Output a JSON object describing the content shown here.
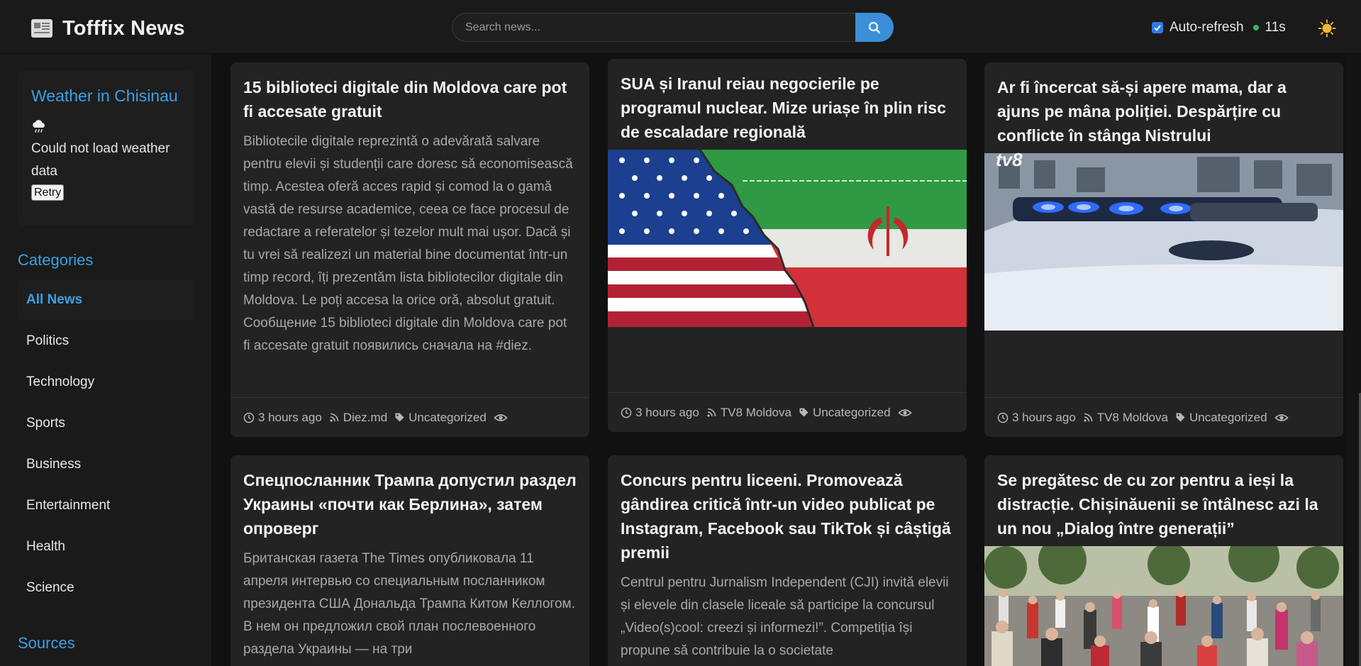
{
  "header": {
    "title": "Tofffix News",
    "search_placeholder": "Search news...",
    "autorefresh_label": "Auto-refresh",
    "autorefresh_checked": true,
    "countdown": "11s",
    "icons": {
      "logo": "newspaper-icon",
      "search": "search-icon",
      "theme": "sun-icon"
    }
  },
  "sidebar": {
    "weather": {
      "title": "Weather in Chisinau",
      "icon": "cloud-rain-icon",
      "message": "Could not load weather data",
      "retry_label": "Retry"
    },
    "categories_heading": "Categories",
    "categories": [
      {
        "label": "All News",
        "active": true
      },
      {
        "label": "Politics",
        "active": false
      },
      {
        "label": "Technology",
        "active": false
      },
      {
        "label": "Sports",
        "active": false
      },
      {
        "label": "Business",
        "active": false
      },
      {
        "label": "Entertainment",
        "active": false
      },
      {
        "label": "Health",
        "active": false
      },
      {
        "label": "Science",
        "active": false
      }
    ],
    "sources_heading": "Sources"
  },
  "articles": [
    {
      "title": "15 biblioteci digitale din Moldova care pot fi accesate gratuit",
      "description": "Bibliotecile digitale reprezintă o adevărată salvare pentru elevii și studenții care doresc să economisească timp. Acestea oferă acces rapid și comod la o gamă vastă de resurse academice, ceea ce face procesul de redactare a referatelor și tezelor mult mai ușor. Dacă și tu vrei să realizezi un material bine documentat într-un timp record, îți prezentăm lista bibliotecilor digitale din Moldova. Le poți accesa la orice oră, absolut gratuit. Сообщение 15 biblioteci digitale din Moldova care pot fi accesate gratuit появились сначала на #diez.",
      "time": "3 hours ago",
      "source": "Diez.md",
      "category": "Uncategorized"
    },
    {
      "title": "SUA și Iranul reiau negocierile pe programul nuclear. Mize uriașe în plin risc de escaladare regională",
      "image": "us-iran-flags-image",
      "time": "3 hours ago",
      "source": "TV8 Moldova",
      "category": "Uncategorized"
    },
    {
      "title": "Ar fi încercat să-și apere mama, dar a ajuns pe mâna poliției. Despărțire cu conflicte în stânga Nistrului",
      "image": "police-car-image",
      "image_watermark": "tv8",
      "time": "3 hours ago",
      "source": "TV8 Moldova",
      "category": "Uncategorized"
    },
    {
      "title": "Спецпосланник Трампа допустил раздел Украины «почти как Берлина», затем опроверг",
      "description": "Британская газета The Times опубликовала 11 апреля интервью со специальным посланником президента США Дональда Трампа Китом Келлогом. В нем он предложил свой план послевоенного раздела Украины — на три"
    },
    {
      "title": "Concurs pentru liceeni. Promovează gândirea critică într-un video publicat pe Instagram, Facebook sau TikTok și câștigă premii",
      "description": "Centrul pentru Jurnalism Independent (CJI) invită elevii și elevele din clasele liceale să participe la concursul „Video(s)cool: creezi și informezi!”. Competiția își propune să contribuie la o societate"
    },
    {
      "title": "Se pregătesc de cu zor pentru a ieși la distracție. Chișinăuenii se întâlnesc azi la un nou „Dialog între generații”",
      "image": "dancing-crowd-park-image"
    }
  ],
  "colors": {
    "accent": "#3aa0e6",
    "search_button": "#3a8fd8",
    "status_dot": "#2eb86b",
    "background": "#111111",
    "panel": "#1a1a1a",
    "card": "#232323"
  }
}
